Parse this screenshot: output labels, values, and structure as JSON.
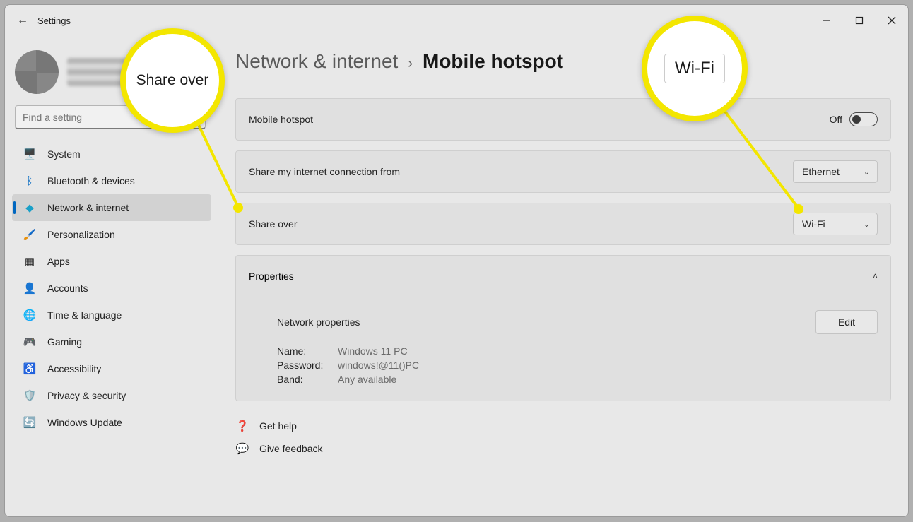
{
  "titlebar": {
    "back": "←",
    "title": "Settings"
  },
  "search": {
    "placeholder": "Find a setting"
  },
  "nav": [
    {
      "icon": "🖥️",
      "label": "System"
    },
    {
      "icon": "ᛒ",
      "label": "Bluetooth & devices",
      "iconColor": "#0067c0"
    },
    {
      "icon": "◆",
      "label": "Network & internet",
      "active": true,
      "iconColor": "#1aa0c8"
    },
    {
      "icon": "🖌️",
      "label": "Personalization"
    },
    {
      "icon": "▦",
      "label": "Apps"
    },
    {
      "icon": "👤",
      "label": "Accounts"
    },
    {
      "icon": "🌐",
      "label": "Time & language"
    },
    {
      "icon": "🎮",
      "label": "Gaming"
    },
    {
      "icon": "♿",
      "label": "Accessibility"
    },
    {
      "icon": "🛡️",
      "label": "Privacy & security"
    },
    {
      "icon": "🔄",
      "label": "Windows Update"
    }
  ],
  "breadcrumb": {
    "parent": "Network & internet",
    "sep": "›",
    "current": "Mobile hotspot"
  },
  "cards": {
    "hotspot": {
      "label": "Mobile hotspot",
      "state": "Off"
    },
    "sharefrom": {
      "label": "Share my internet connection from",
      "value": "Ethernet"
    },
    "shareover": {
      "label": "Share over",
      "value": "Wi-Fi"
    }
  },
  "properties": {
    "header": "Properties",
    "title": "Network properties",
    "edit": "Edit",
    "rows": {
      "nameK": "Name:",
      "nameV": "Windows 11 PC",
      "passK": "Password:",
      "passV": "windows!@11()PC",
      "bandK": "Band:",
      "bandV": "Any available"
    }
  },
  "links": {
    "help": "Get help",
    "feedback": "Give feedback"
  },
  "callouts": {
    "left": "Share over",
    "right": "Wi-Fi"
  }
}
